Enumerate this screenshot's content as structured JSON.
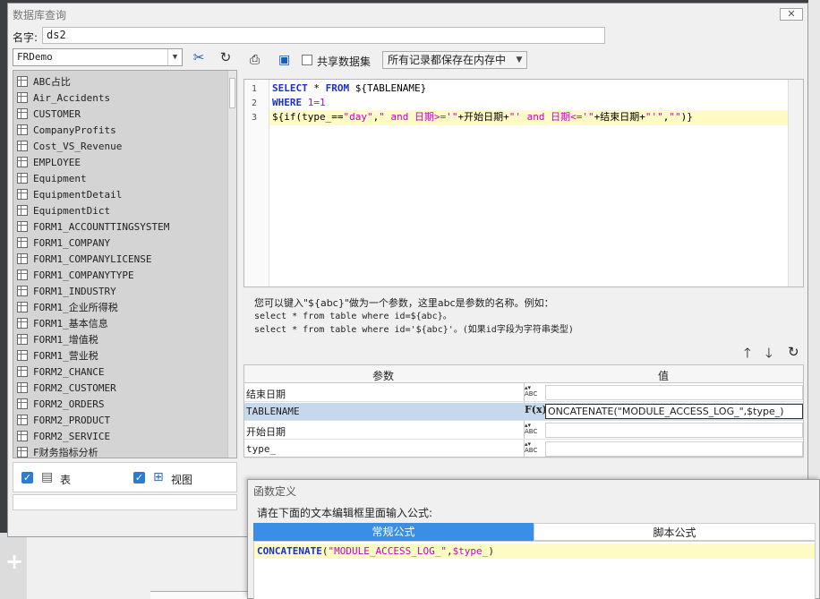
{
  "dialog": {
    "title": "数据库查询",
    "close_label": "✕",
    "name_label": "名字:",
    "name_value": "ds2"
  },
  "left": {
    "datasource": "FRDemo",
    "tables": [
      "ABC占比",
      "Air_Accidents",
      "CUSTOMER",
      "CompanyProfits",
      "Cost_VS_Revenue",
      "EMPLOYEE",
      "Equipment",
      "EquipmentDetail",
      "EquipmentDict",
      "FORM1_ACCOUNTTINGSYSTEM",
      "FORM1_COMPANY",
      "FORM1_COMPANYLICENSE",
      "FORM1_COMPANYTYPE",
      "FORM1_INDUSTRY",
      "FORM1_企业所得税",
      "FORM1_基本信息",
      "FORM1_增值税",
      "FORM1_营业税",
      "FORM2_CHANCE",
      "FORM2_CUSTOMER",
      "FORM2_ORDERS",
      "FORM2_PRODUCT",
      "FORM2_SERVICE",
      "F财务指标分析"
    ],
    "filter_table_label": "表",
    "filter_view_label": "视图"
  },
  "toolbar": {
    "share_label": "共享数据集",
    "memory_option": "所有记录都保存在内存中"
  },
  "sql": {
    "line_numbers": [
      "1",
      "2",
      "3"
    ],
    "line1": {
      "kw1": "SELECT",
      "mid": " * ",
      "kw2": "FROM",
      "rest": " ${TABLENAME}"
    },
    "line2": {
      "kw": "WHERE",
      "num": " 1=1"
    },
    "line3": {
      "p1": "${if(",
      "p2": "type_==",
      "s1": "\"day\"",
      ",": ",",
      "s2": "\" and 日期>='\"",
      "p3": "+开始日期+",
      "s3": "\"' and 日期<='\"",
      "p4": "+结束日期+",
      "s4": "\"'\"",
      ",2": ",",
      "s5": "\"\"",
      "end": ")}"
    }
  },
  "hint": {
    "line1": "您可以键入\"${abc}\"做为一个参数，这里abc是参数的名称。例如：",
    "line2": "select * from table where id=${abc}。",
    "line3": "select * from table where id='${abc}'。(如果id字段为字符串类型)"
  },
  "params": {
    "col_param": "参数",
    "col_value": "值",
    "rows": [
      {
        "name": "结束日期",
        "value": ""
      },
      {
        "name": "TABLENAME",
        "value": "ONCATENATE(\"MODULE_ACCESS_LOG_\",$type_)"
      },
      {
        "name": "开始日期",
        "value": ""
      },
      {
        "name": "type_",
        "value": ""
      }
    ]
  },
  "func_dialog": {
    "title": "函数定义",
    "prompt": "请在下面的文本编辑框里面输入公式:",
    "tab_regular": "常规公式",
    "tab_script": "脚本公式",
    "formula": {
      "fn": "CONCATENATE",
      "open": "(",
      "str": "\"MODULE_ACCESS_LOG_\"",
      "comma": ",",
      "var": "$type_",
      "close": ")"
    }
  },
  "colors": {
    "accent": "#3a8ee6",
    "highlight": "#fefcc4",
    "keyword": "#1a2fd0",
    "string": "#c800c8"
  }
}
